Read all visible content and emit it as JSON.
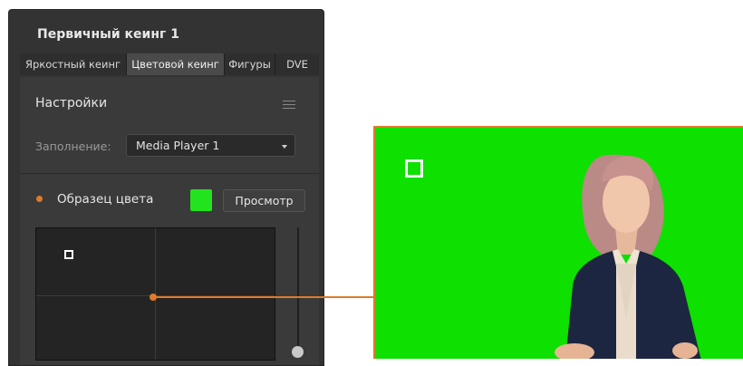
{
  "panel": {
    "title": "Первичный кеинг 1",
    "tabs": [
      {
        "label": "Яркостный кеинг",
        "active": false
      },
      {
        "label": "Цветовой кеинг",
        "active": true
      },
      {
        "label": "Фигуры",
        "active": false
      },
      {
        "label": "DVE",
        "active": false
      }
    ],
    "section_title": "Настройки",
    "fill_label": "Заполнение:",
    "fill_value": "Media Player 1",
    "sample_label": "Образец цвета",
    "preview_button": "Просмотр"
  },
  "colors": {
    "accent": "#e07a2a",
    "key_green": "#22e31e",
    "panel_bg": "#333333"
  },
  "icons": [
    "menu-icon",
    "dropdown-arrow-icon"
  ]
}
